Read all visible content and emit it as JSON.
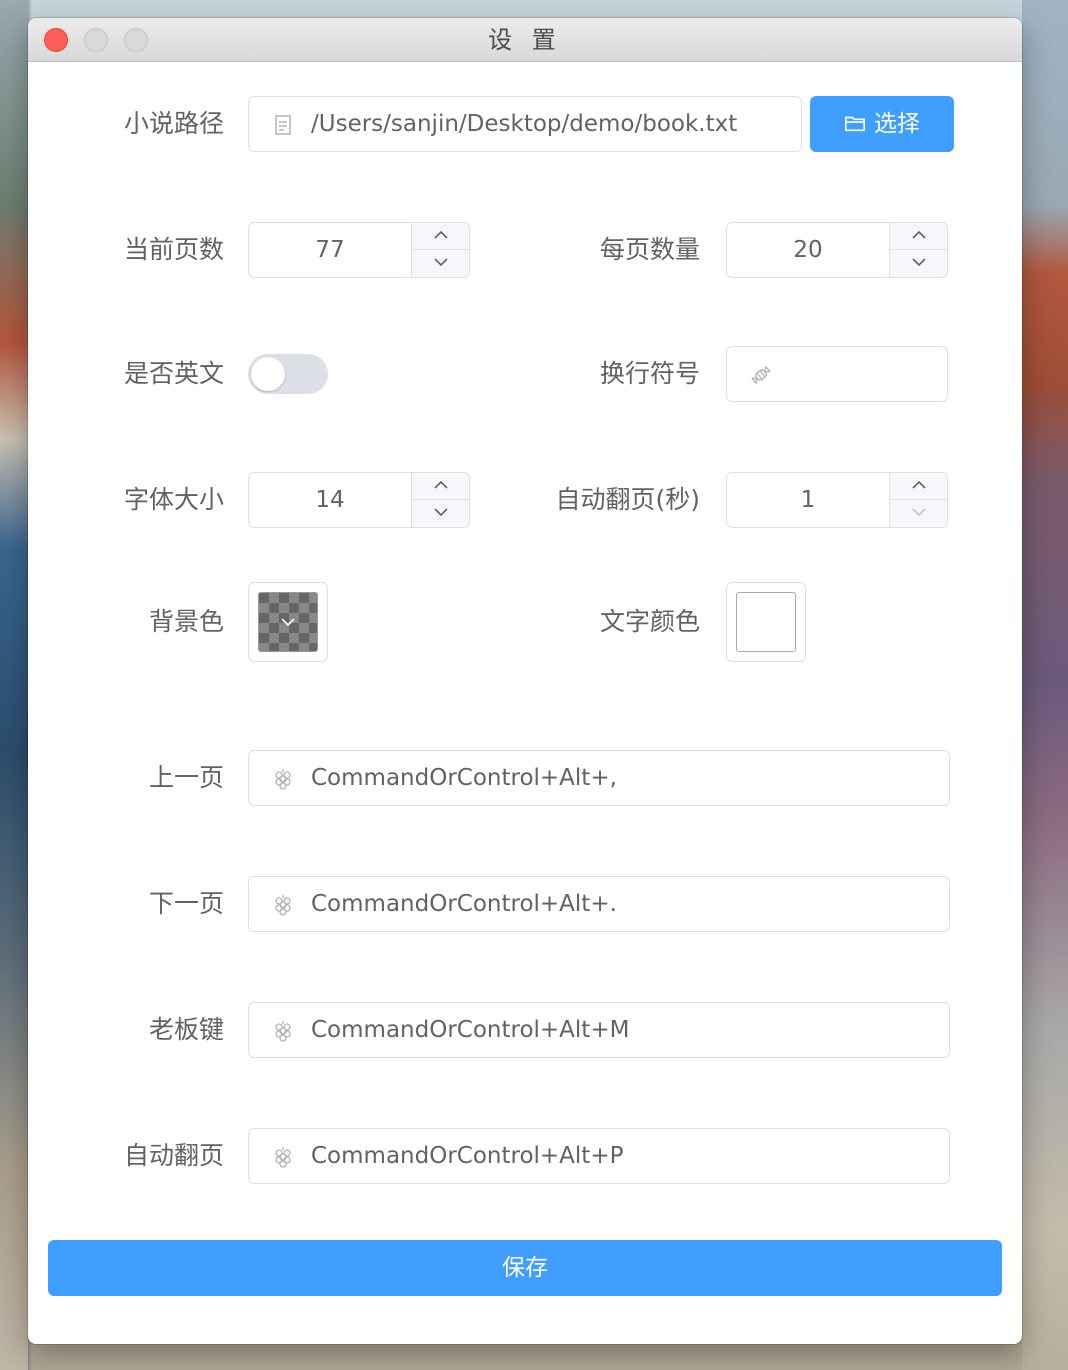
{
  "window": {
    "title": "设 置"
  },
  "fields": {
    "novel_path": {
      "label": "小说路径",
      "value": "/Users/sanjin/Desktop/demo/book.txt",
      "icon": "document-icon",
      "button_label": "选择",
      "button_icon": "folder-icon"
    },
    "current_page": {
      "label": "当前页数",
      "value": "77"
    },
    "per_page": {
      "label": "每页数量",
      "value": "20"
    },
    "is_english": {
      "label": "是否英文",
      "on": false
    },
    "line_break": {
      "label": "换行符号",
      "value": "",
      "icon": "candy-icon"
    },
    "font_size": {
      "label": "字体大小",
      "value": "14"
    },
    "auto_flip_seconds": {
      "label": "自动翻页(秒)",
      "value": "1"
    },
    "bg_color": {
      "label": "背景色",
      "value": "transparent"
    },
    "text_color": {
      "label": "文字颜色",
      "value": "#ffffff"
    }
  },
  "shortcuts": [
    {
      "label": "上一页",
      "value": "CommandOrControl+Alt+,",
      "icon": "grape-icon"
    },
    {
      "label": "下一页",
      "value": "CommandOrControl+Alt+.",
      "icon": "grape-icon"
    },
    {
      "label": "老板键",
      "value": "CommandOrControl+Alt+M",
      "icon": "grape-icon"
    },
    {
      "label": "自动翻页",
      "value": "CommandOrControl+Alt+P",
      "icon": "grape-icon"
    }
  ],
  "save_label": "保存",
  "colors": {
    "primary": "#409eff",
    "border": "#dcdfe6",
    "label_text": "#606266",
    "close_button": "#fc5f57"
  }
}
